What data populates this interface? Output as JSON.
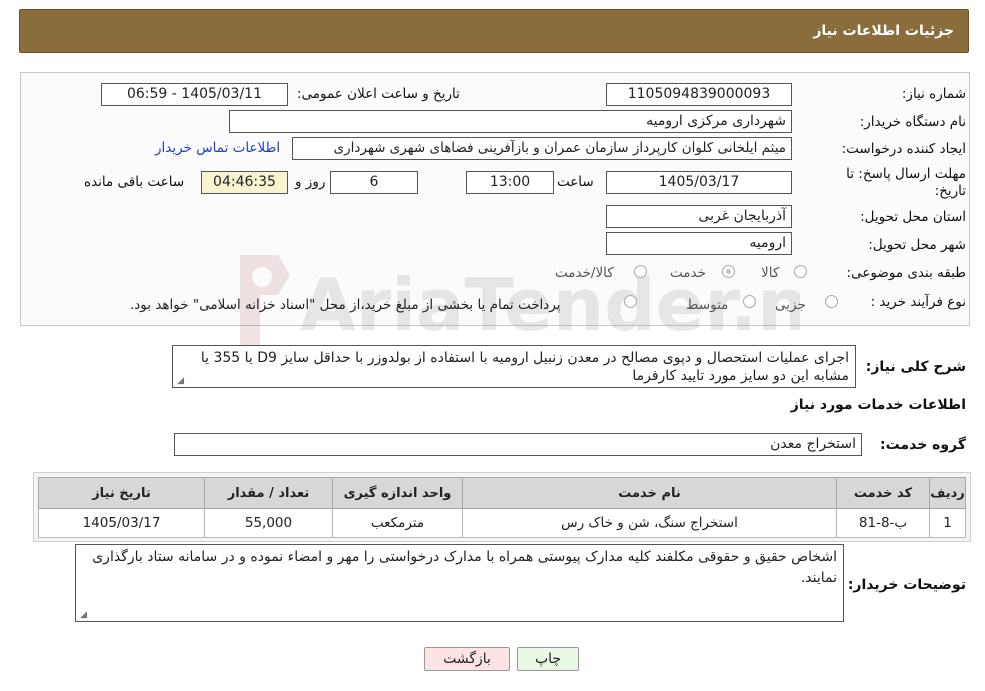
{
  "header": {
    "title": "جزئیات اطلاعات نیاز"
  },
  "fields": {
    "need_number": {
      "label": "شماره نیاز:",
      "value": "1105094839000093"
    },
    "announce_datetime": {
      "label": "تاریخ و ساعت اعلان عمومی:",
      "value": "1405/03/11 - 06:59"
    },
    "buyer_org": {
      "label": "نام دستگاه خریدار:",
      "value": "شهرداری مرکزی ارومیه"
    },
    "requester": {
      "label": "ایجاد کننده درخواست:",
      "value": "میثم ایلخانی کلوان کارپرداز سازمان عمران و بازآفرینی فضاهای شهری شهرداری",
      "contact_link": "اطلاعات تماس خریدار"
    },
    "deadline": {
      "label_line1": "مهلت ارسال پاسخ: تا",
      "label_line2": "تاریخ:",
      "date": "1405/03/17",
      "time_label": "ساعت",
      "time": "13:00",
      "days": "6",
      "days_label": "روز و",
      "remaining": "04:46:35",
      "remaining_label": "ساعت باقی مانده"
    },
    "province": {
      "label": "استان محل تحویل:",
      "value": "آذربایجان غربی"
    },
    "city": {
      "label": "شهر محل تحویل:",
      "value": "ارومیه"
    },
    "category": {
      "label": "طبقه بندی موضوعی:",
      "options": [
        "کالا",
        "خدمت",
        "کالا/خدمت"
      ],
      "selected": "خدمت"
    },
    "purchase_type": {
      "label": "نوع فرآیند خرید :",
      "options": [
        "جزیی",
        "متوسط"
      ],
      "note": "پرداخت تمام یا بخشی از مبلغ خرید،از محل \"اسناد خزانه اسلامی\" خواهد بود."
    }
  },
  "general_desc": {
    "label": "شرح کلی نیاز:",
    "value": "اجرای عملیات استحصال و دپوی مصالح در معدن زنبیل ارومیه با استفاده از بولدوزر با حداقل سایز D9 یا 355 یا مشابه این دو سایز مورد تایید کارفرما"
  },
  "services_section": {
    "title": "اطلاعات خدمات مورد نیاز",
    "group_label": "گروه خدمت:",
    "group_value": "استخراج معدن"
  },
  "table": {
    "headers": [
      "ردیف",
      "کد خدمت",
      "نام خدمت",
      "واحد اندازه گیری",
      "تعداد / مقدار",
      "تاریخ نیاز"
    ],
    "rows": [
      [
        "1",
        "ب-8-81",
        "استخراج سنگ، شن و خاک رس",
        "مترمکعب",
        "55,000",
        "1405/03/17"
      ]
    ]
  },
  "buyer_notes": {
    "label": "توضیحات خریدار:",
    "value": "اشخاص حقیق و حقوقی مکلفند کلیه مدارک پیوستی همراه با مدارک درخواستی را مهر و امضاء نموده و در سامانه ستاد بارگذاری نمایند."
  },
  "buttons": {
    "print": "چاپ",
    "back": "بازگشت"
  },
  "watermark": {
    "text": "AriaTender.neT"
  },
  "colors": {
    "header_bg": "#8b6d3c",
    "link": "#1a3ecc",
    "back_button": "#fde3e3",
    "print_button": "#e8f8e4"
  }
}
